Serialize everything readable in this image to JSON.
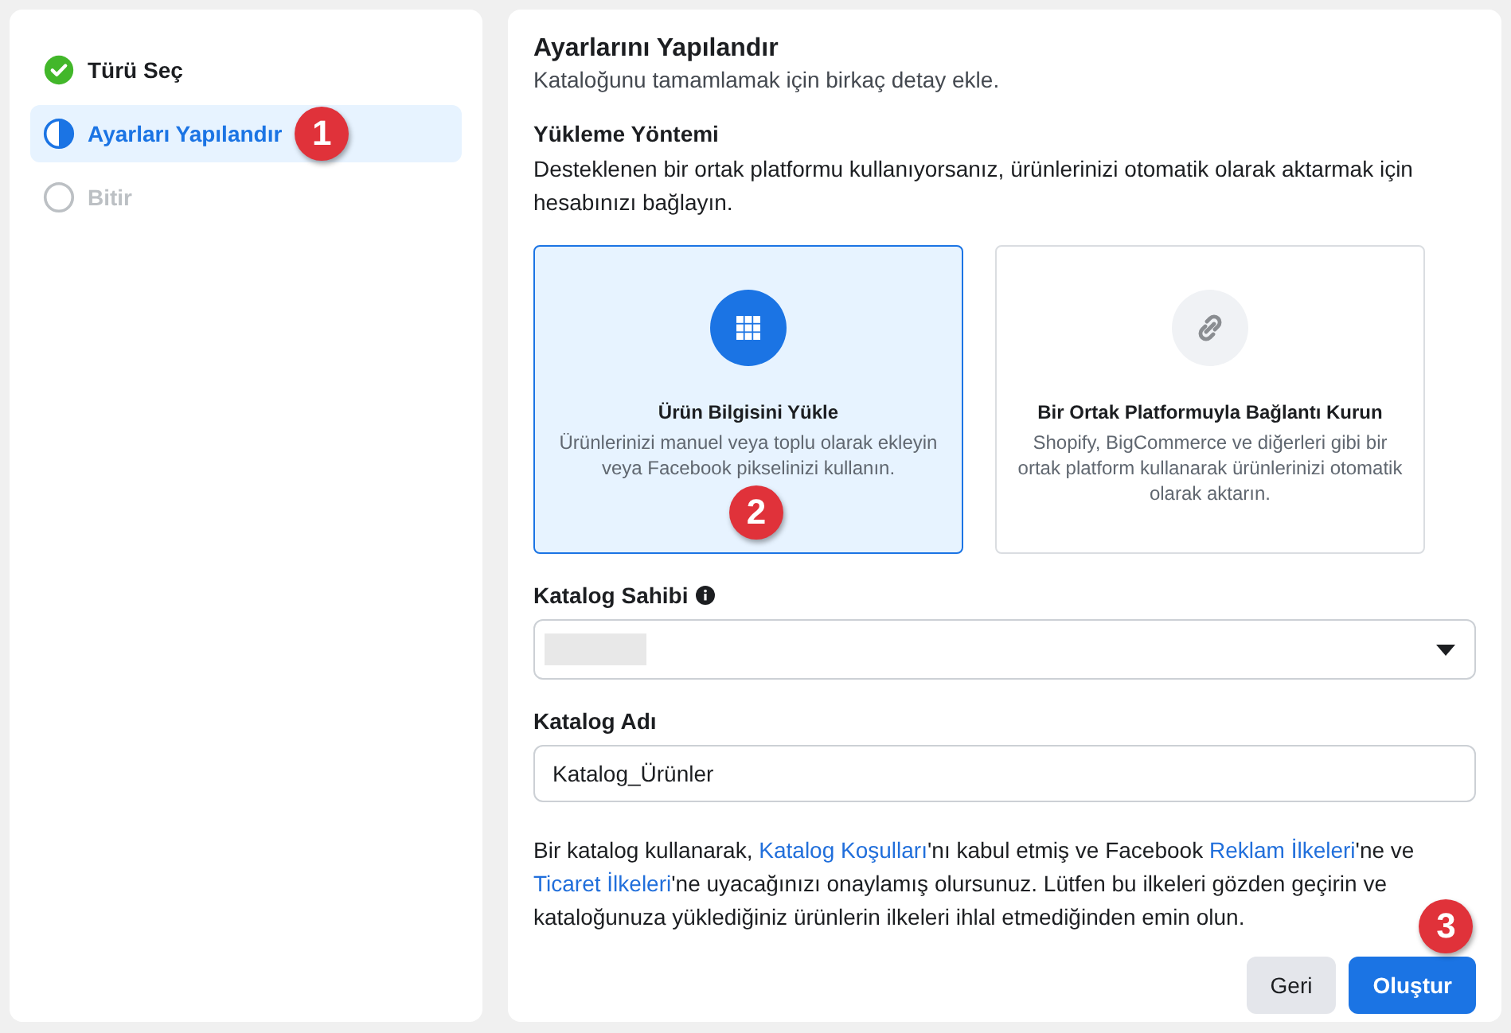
{
  "steps": [
    {
      "label": "Türü Seç",
      "kind": "done",
      "selected": false
    },
    {
      "label": "Ayarları Yapılandır",
      "kind": "current",
      "selected": true,
      "badge": "1"
    },
    {
      "label": "Bitir",
      "kind": "pending",
      "selected": false
    }
  ],
  "main": {
    "title": "Ayarlarını Yapılandır",
    "subtitle": "Kataloğunu tamamlamak için birkaç detay ekle.",
    "method_heading": "Yükleme Yöntemi",
    "method_description": "Desteklenen bir ortak platformu kullanıyorsanız, ürünlerinizi otomatik olarak aktarmak için hesabınızı bağlayın.",
    "methods": [
      {
        "kind": "grid",
        "title": "Ürün Bilgisini Yükle",
        "description": "Ürünlerinizi manuel veya toplu olarak ekleyin veya Facebook pikselinizi kullanın.",
        "selected": true,
        "badge": "2"
      },
      {
        "kind": "link",
        "title": "Bir Ortak Platformuyla Bağlantı Kurun",
        "description": "Shopify, BigCommerce ve diğerleri gibi bir ortak platform kullanarak ürünlerinizi otomatik olarak aktarın.",
        "selected": false
      }
    ],
    "owner": {
      "label": "Katalog Sahibi",
      "redacted": true
    },
    "name_field": {
      "label": "Katalog Adı",
      "value": "Katalog_Ürünler"
    },
    "terms": [
      {
        "kind": "text",
        "text": "Bir katalog kullanarak, "
      },
      {
        "kind": "link",
        "text": "Katalog Koşulları"
      },
      {
        "kind": "text",
        "text": "'nı kabul etmiş ve Facebook "
      },
      {
        "kind": "link",
        "text": "Reklam İlkeleri"
      },
      {
        "kind": "text",
        "text": "'ne ve "
      },
      {
        "kind": "link",
        "text": "Ticaret İlkeleri"
      },
      {
        "kind": "text",
        "text": "'ne uyacağınızı onaylamış olursunuz. Lütfen bu ilkeleri gözden geçirin ve kataloğunuza yüklediğiniz ürünlerin ilkeleri ihlal etmediğinden emin olun."
      }
    ],
    "buttons": [
      {
        "kind": "secondary",
        "label": "Geri"
      },
      {
        "kind": "primary",
        "label": "Oluştur",
        "badge": "3"
      }
    ]
  }
}
